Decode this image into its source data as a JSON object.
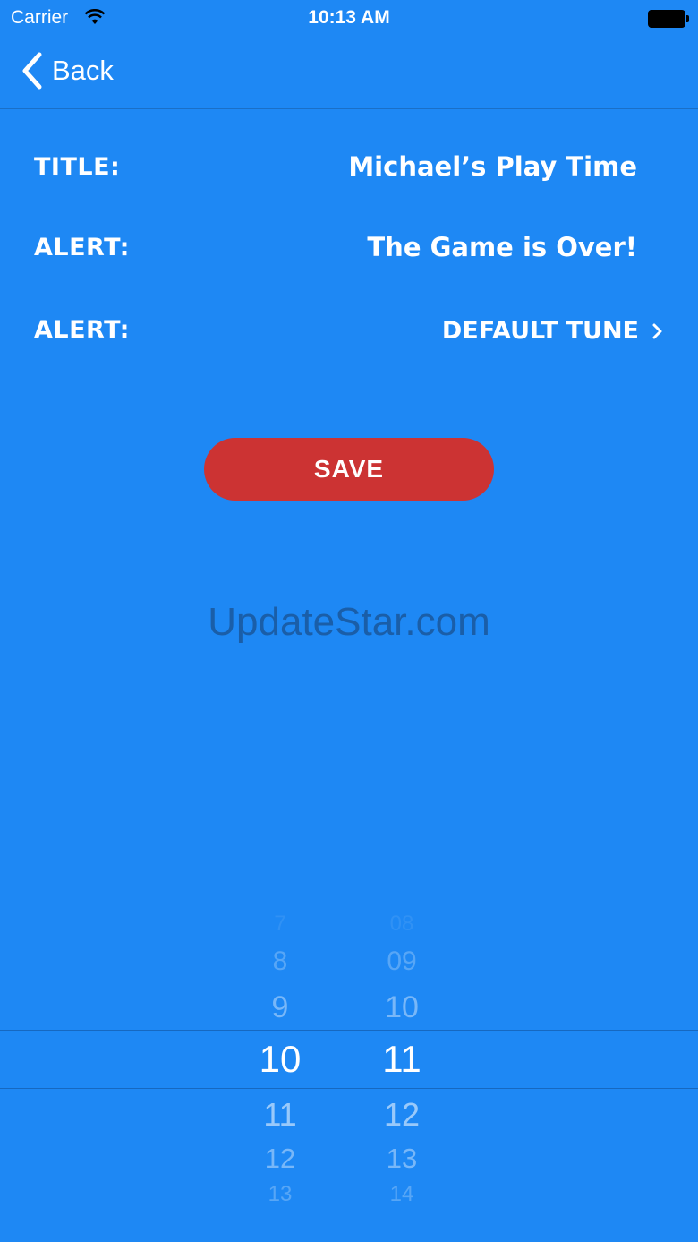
{
  "status_bar": {
    "carrier": "Carrier",
    "time": "10:13 AM"
  },
  "nav": {
    "back_label": "Back"
  },
  "form": {
    "rows": [
      {
        "label": "TITLE:",
        "value": "Michael’s Play Time"
      },
      {
        "label": "ALERT:",
        "value": "The Game is Over!"
      },
      {
        "label": "ALERT:",
        "value": "DEFAULT TUNE"
      }
    ],
    "save_label": "SAVE"
  },
  "watermark": "UpdateStar.com",
  "time_picker": {
    "hours": [
      "7",
      "8",
      "9",
      "10",
      "11",
      "12",
      "13"
    ],
    "minutes": [
      "08",
      "09",
      "10",
      "11",
      "12",
      "13",
      "14"
    ],
    "selected_hour": "10",
    "selected_minute": "11"
  },
  "colors": {
    "background": "#1e88f4",
    "save_button": "#cc3333",
    "text": "#ffffff"
  },
  "icons": [
    "wifi-icon",
    "battery-icon",
    "back-chevron-icon",
    "chevron-right-icon"
  ]
}
